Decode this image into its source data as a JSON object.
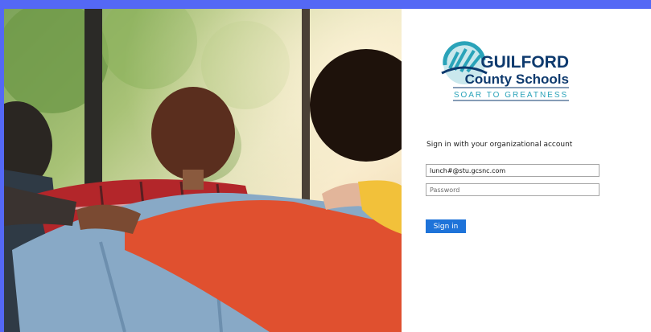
{
  "logo": {
    "name_line1": "GUILFORD",
    "name_line2": "County Schools",
    "tagline": "SOAR TO GREATNESS",
    "brand_navy": "#0e3a6e",
    "brand_teal": "#2aa3b9"
  },
  "signin": {
    "prompt": "Sign in with your organizational account",
    "email_value": "lunch#@stu.gcsnc.com",
    "password_placeholder": "Password",
    "button_label": "Sign in"
  },
  "colors": {
    "outer_background": "#5468f5",
    "button": "#1e73d9"
  }
}
